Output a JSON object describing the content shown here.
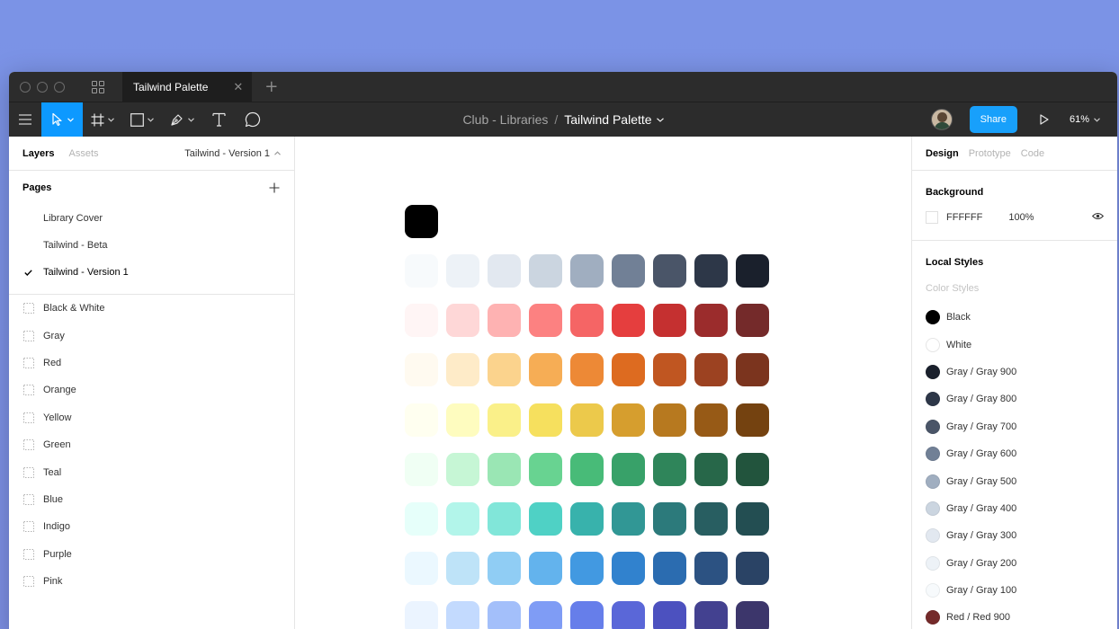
{
  "titlebar": {
    "tab_title": "Tailwind Palette",
    "tab_close": "✕",
    "new_tab": "+"
  },
  "toolbar": {
    "breadcrumb_team": "Club - Libraries",
    "breadcrumb_sep": "/",
    "breadcrumb_file": "Tailwind Palette",
    "share_label": "Share",
    "zoom_label": "61%"
  },
  "left_panel": {
    "tab_layers": "Layers",
    "tab_assets": "Assets",
    "version_label": "Tailwind - Version 1",
    "pages_title": "Pages",
    "pages": [
      {
        "label": "Library Cover",
        "current": false
      },
      {
        "label": "Tailwind - Beta",
        "current": false
      },
      {
        "label": "Tailwind - Version 1",
        "current": true
      }
    ],
    "layers": [
      "Black & White",
      "Gray",
      "Red",
      "Orange",
      "Yellow",
      "Green",
      "Teal",
      "Blue",
      "Indigo",
      "Purple",
      "Pink"
    ]
  },
  "right_panel": {
    "tab_design": "Design",
    "tab_prototype": "Prototype",
    "tab_code": "Code",
    "background_title": "Background",
    "background_hex": "FFFFFF",
    "background_opacity": "100%",
    "local_styles_title": "Local Styles",
    "color_styles_label": "Color Styles",
    "styles": [
      {
        "name": "Black",
        "color": "#000000"
      },
      {
        "name": "White",
        "color": "#ffffff"
      },
      {
        "name": "Gray / Gray 900",
        "color": "#1a202c"
      },
      {
        "name": "Gray / Gray 800",
        "color": "#2d3748"
      },
      {
        "name": "Gray / Gray 700",
        "color": "#4a5568"
      },
      {
        "name": "Gray / Gray 600",
        "color": "#718096"
      },
      {
        "name": "Gray / Gray 500",
        "color": "#a0aec0"
      },
      {
        "name": "Gray / Gray 400",
        "color": "#cbd5e0"
      },
      {
        "name": "Gray / Gray 300",
        "color": "#e2e8f0"
      },
      {
        "name": "Gray / Gray 200",
        "color": "#edf2f7"
      },
      {
        "name": "Gray / Gray 100",
        "color": "#f7fafc"
      },
      {
        "name": "Red / Red 900",
        "color": "#742a2a"
      }
    ]
  },
  "canvas": {
    "black_swatch": "#000000",
    "palette": [
      [
        "#f7fafc",
        "#edf2f7",
        "#e2e8f0",
        "#cbd5e0",
        "#a0aec0",
        "#718096",
        "#4a5568",
        "#2d3748",
        "#1a202c"
      ],
      [
        "#fff5f5",
        "#fed7d7",
        "#feb2b2",
        "#fc8181",
        "#f56565",
        "#e53e3e",
        "#c53030",
        "#9b2c2c",
        "#742a2a"
      ],
      [
        "#fffaf0",
        "#feebc8",
        "#fbd38d",
        "#f6ad55",
        "#ed8936",
        "#dd6b20",
        "#c05621",
        "#9c4221",
        "#7b341e"
      ],
      [
        "#fffff0",
        "#fefcbf",
        "#faf089",
        "#f6e05e",
        "#ecc94b",
        "#d69e2e",
        "#b7791f",
        "#975a16",
        "#744210"
      ],
      [
        "#f0fff4",
        "#c6f6d5",
        "#9ae6b4",
        "#68d391",
        "#48bb78",
        "#38a169",
        "#2f855a",
        "#276749",
        "#22543d"
      ],
      [
        "#e6fffa",
        "#b2f5ea",
        "#81e6d9",
        "#4fd1c5",
        "#38b2ac",
        "#319795",
        "#2c7a7b",
        "#285e61",
        "#234e52"
      ],
      [
        "#ebf8ff",
        "#bee3f8",
        "#90cdf4",
        "#63b3ed",
        "#4299e1",
        "#3182ce",
        "#2b6cb0",
        "#2c5282",
        "#2a4365"
      ],
      [
        "#ebf4ff",
        "#c3dafe",
        "#a3bffa",
        "#7f9cf5",
        "#667eea",
        "#5a67d8",
        "#4c51bf",
        "#434190",
        "#3c366b"
      ]
    ]
  }
}
